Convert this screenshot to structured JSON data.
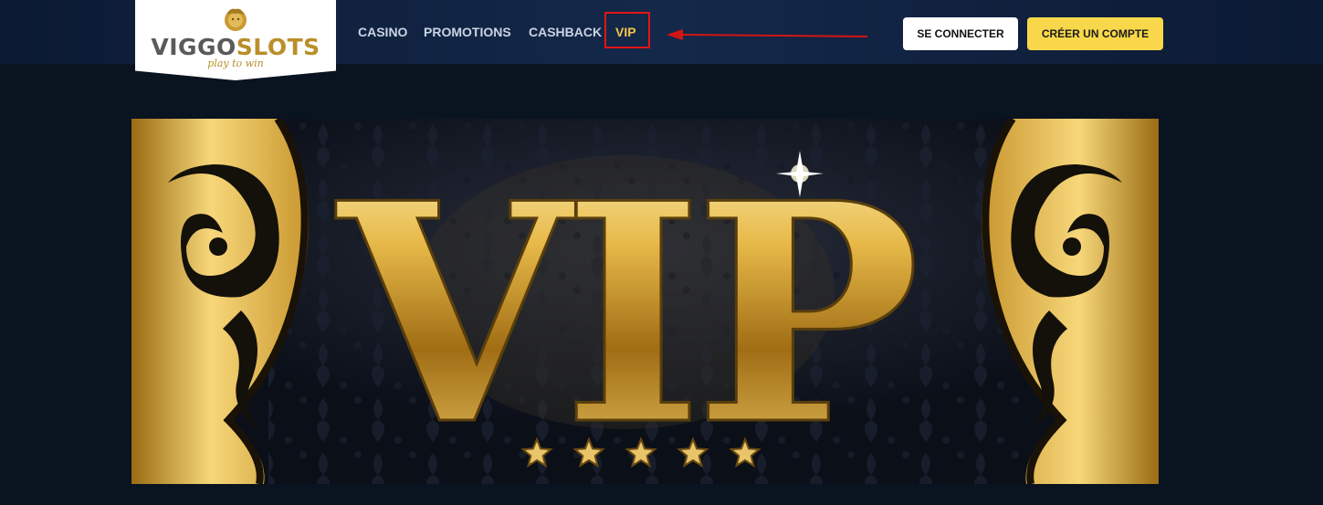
{
  "logo": {
    "brand_part1": "VIGGO",
    "brand_part2": "SLOTS",
    "tagline": "play to win"
  },
  "nav": {
    "items": [
      "CASINO",
      "PROMOTIONS",
      "CASHBACK",
      "VIP"
    ]
  },
  "auth": {
    "login_label": "SE CONNECTER",
    "register_label": "CRÉER UN COMPTE"
  },
  "banner": {
    "headline": "VIP",
    "star_count": 5
  },
  "colors": {
    "header_bg": "#0c1a33",
    "page_bg": "#0a1320",
    "accent_gold": "#f3c54a",
    "register_button": "#f8d84a",
    "highlight_red": "#e01515"
  }
}
